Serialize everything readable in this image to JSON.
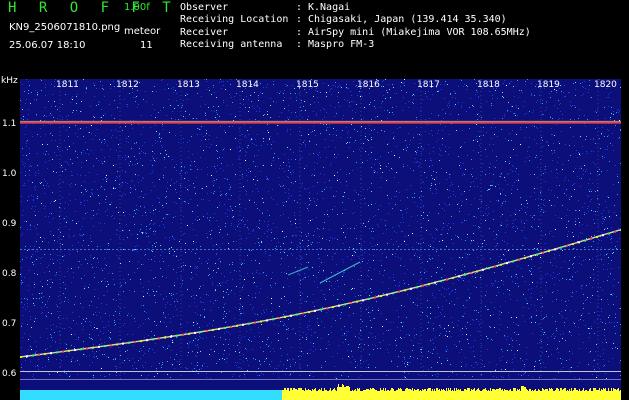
{
  "header": {
    "app_title": "H R O F F T",
    "version": "1.00f",
    "filename": "KN9_2506071810.png",
    "mode": "meteor",
    "datetime": "25.06.07 18:10",
    "count": "11"
  },
  "info": {
    "observer_label": "Observer",
    "observer_value": "K.Nagai",
    "location_label": "Receiving Location",
    "location_value": "Chigasaki, Japan (139.414 35.340)",
    "receiver_label": "Receiver",
    "receiver_value": "AirSpy mini (Miakejima VOR 108.65MHz)",
    "antenna_label": "Receiving antenna",
    "antenna_value": "Maspro FM-3",
    "separator": ":"
  },
  "plot": {
    "unit_label": "kHz",
    "x_ticks": [
      "1811",
      "1812",
      "1813",
      "1814",
      "1815",
      "1816",
      "1817",
      "1818",
      "1819",
      "1820"
    ],
    "y_ticks": [
      "1.1",
      "1.0",
      "0.9",
      "0.8",
      "0.7",
      "0.6"
    ],
    "background_color": "#0c0f7a",
    "noise_colors": [
      "#1a3df0",
      "#2a9ef0",
      "#4de4e4",
      "#8ad8ff",
      "#ffffff",
      "#f0f000"
    ],
    "carrier_color": "#e04848",
    "trace_color": "#f0f0a0",
    "spectrum_left_color": "#33ddff",
    "spectrum_right_color": "#ffff33"
  }
}
